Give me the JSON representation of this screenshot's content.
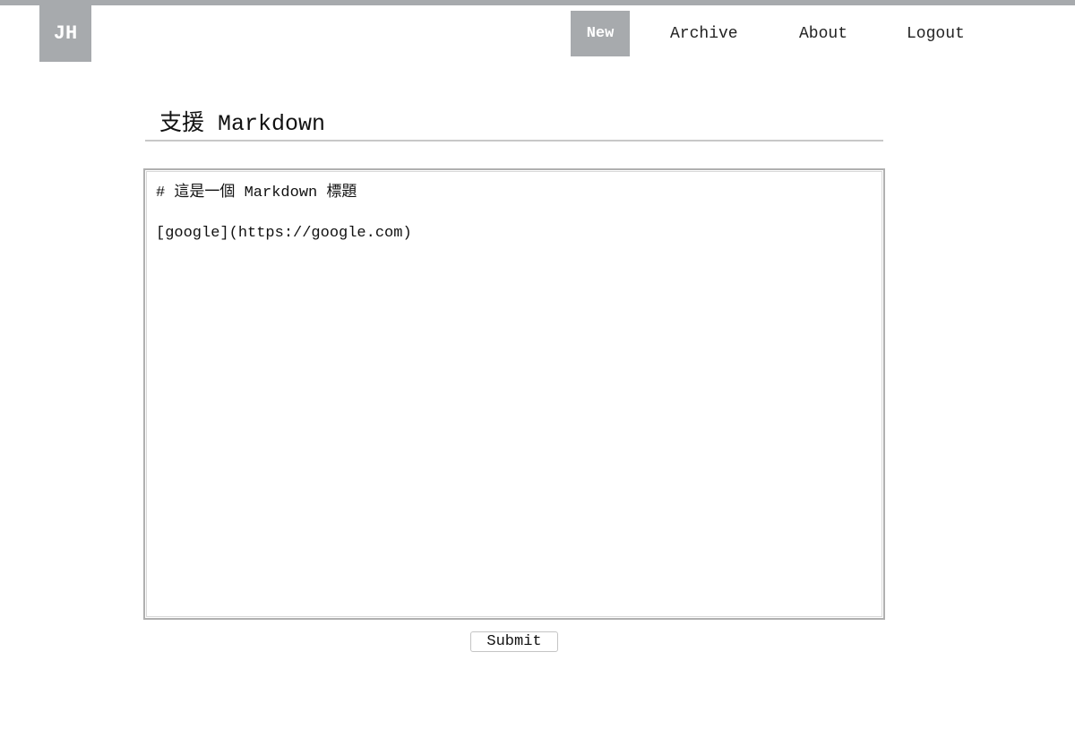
{
  "header": {
    "logo": "JH",
    "nav": [
      {
        "label": "New",
        "active": true
      },
      {
        "label": "Archive"
      },
      {
        "label": "About"
      },
      {
        "label": "Logout"
      }
    ]
  },
  "main": {
    "title": "支援 Markdown",
    "editor_lines": [
      "# 這是一個 Markdown 標題",
      "[google](https://google.com)"
    ],
    "submit_label": "Submit"
  }
}
